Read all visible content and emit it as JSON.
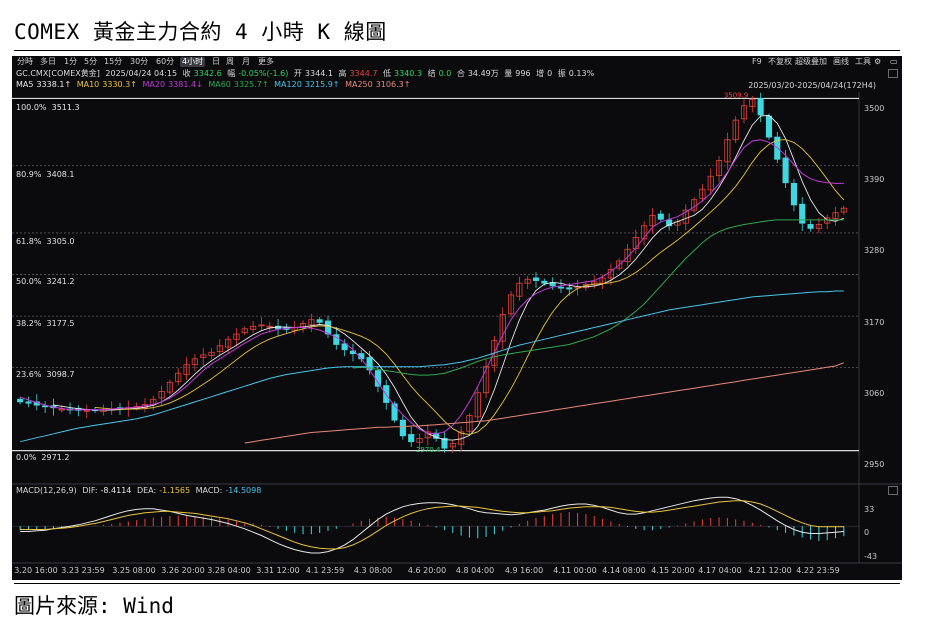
{
  "page": {
    "title": "COMEX 黃金主力合約 4 小時 K 線圖",
    "source": "圖片來源: Wind"
  },
  "toolbar": {
    "timeframes": [
      "分時",
      "多日",
      "1分",
      "5分",
      "15分",
      "30分",
      "60分",
      "4小时",
      "日",
      "周",
      "月",
      "更多"
    ],
    "active_timeframe": "4小时",
    "right_items": [
      "F9",
      "不复权",
      "超级叠加",
      "画线",
      "工具"
    ],
    "settings_icon": "gear-icon",
    "minimize_icon": "minimize-icon"
  },
  "info_line": {
    "symbol": "GC.CMX[COMEX黄金]",
    "datetime": "2025/04/24 04:15",
    "close_label": "收",
    "close": "3342.6",
    "change_label": "幅",
    "change": "-0.05%(-1.6)",
    "open_label": "开",
    "open": "3344.1",
    "high_label": "高",
    "high": "3344.7",
    "low_label": "低",
    "low": "3340.3",
    "settle_label": "结",
    "settle": "0.0",
    "turnover_label": "合",
    "turnover": "34.49万",
    "volume_label": "量",
    "volume": "996",
    "oi_change_label": "增",
    "oi_change": "0",
    "amplitude_label": "振",
    "amplitude": "0.13%"
  },
  "ma_line": [
    {
      "name": "MA5",
      "value": "3338.1↑",
      "color": "#e8e8e8"
    },
    {
      "name": "MA10",
      "value": "3330.3↑",
      "color": "#e8c33b"
    },
    {
      "name": "MA20",
      "value": "3381.4↓",
      "color": "#c03bd6"
    },
    {
      "name": "MA60",
      "value": "3325.7↑",
      "color": "#2fa84f"
    },
    {
      "name": "MA120",
      "value": "3215.9↑",
      "color": "#47c6e8"
    },
    {
      "name": "MA250",
      "value": "3106.3↑",
      "color": "#e8887a"
    }
  ],
  "range_label": "2025/03/20-2025/04/24(172H4)",
  "macd_legend": {
    "title": "MACD(12,26,9)",
    "dif_label": "DIF:",
    "dif": "-8.4114",
    "dea_label": "DEA:",
    "dea": "-1.1565",
    "macd_label": "MACD:",
    "macd": "-14.5098"
  },
  "colors": {
    "up": "#e8413b",
    "down": "#3fd7e0",
    "background": "#0b0b0d",
    "grid": "#5a5a62",
    "fib_line": "#d9d9de"
  },
  "chart_data": [
    {
      "type": "candlestick",
      "title": "COMEX 黃金主力合約 4 小時 K 線圖",
      "x_tick_labels": [
        "3.20 16:00",
        "3.23 23:59",
        "3.25 08:00",
        "3.26 20:00",
        "3.28 04:00",
        "3.31 12:00",
        "4.1 23:59",
        "4.3 08:00",
        "4.6 20:00",
        "4.8 04:00",
        "4.9 16:00",
        "4.11 00:00",
        "4.14 08:00",
        "4.15 20:00",
        "4.17 04:00",
        "4.21 12:00",
        "4.22 23:59"
      ],
      "y_ticks": [
        2950,
        3060,
        3170,
        3280,
        3390,
        3500
      ],
      "ylim": [
        2940,
        3515
      ],
      "fibonacci": [
        {
          "label": "100.0%",
          "value": 3511.3,
          "text": "3511.3"
        },
        {
          "label": "80.9%",
          "value": 3408.1,
          "text": "3408.1"
        },
        {
          "label": "61.8%",
          "value": 3305.0,
          "text": "3305.0"
        },
        {
          "label": "50.0%",
          "value": 3241.2,
          "text": "3241.2"
        },
        {
          "label": "38.2%",
          "value": 3177.5,
          "text": "3177.5"
        },
        {
          "label": "23.6%",
          "value": 3098.7,
          "text": "3098.7"
        },
        {
          "label": "0.0%",
          "value": 2971.2,
          "text": "2971.2"
        }
      ],
      "annotations": [
        {
          "text": "3509.9",
          "value": 3509.9,
          "kind": "high"
        },
        {
          "text": "2970.4",
          "value": 2970.4,
          "kind": "low"
        }
      ],
      "close_path": [
        3046,
        3044,
        3041,
        3039,
        3037,
        3035,
        3034,
        3033,
        3033,
        3033,
        3034,
        3035,
        3036,
        3037,
        3039,
        3042,
        3050,
        3062,
        3076,
        3090,
        3103,
        3112,
        3118,
        3122,
        3132,
        3142,
        3150,
        3158,
        3162,
        3164,
        3162,
        3158,
        3157,
        3160,
        3166,
        3172,
        3168,
        3150,
        3134,
        3126,
        3120,
        3112,
        3095,
        3070,
        3045,
        3018,
        2994,
        2985,
        2990,
        3000,
        2990,
        2975,
        2982,
        3000,
        3025,
        3060,
        3100,
        3140,
        3180,
        3210,
        3228,
        3234,
        3232,
        3228,
        3224,
        3221,
        3219,
        3222,
        3226,
        3230,
        3236,
        3249,
        3262,
        3280,
        3298,
        3316,
        3332,
        3326,
        3316,
        3322,
        3340,
        3356,
        3372,
        3392,
        3416,
        3448,
        3478,
        3500,
        3510,
        3486,
        3452,
        3418,
        3382,
        3348,
        3320,
        3312,
        3318,
        3328,
        3336,
        3343
      ],
      "moving_averages": [
        {
          "name": "MA20",
          "values": [
            3053,
            3049,
            3045,
            3041,
            3038,
            3036,
            3034,
            3034,
            3034,
            3034,
            3034,
            3035,
            3036,
            3037,
            3038,
            3040,
            3042,
            3046,
            3052,
            3060,
            3070,
            3082,
            3094,
            3104,
            3112,
            3120,
            3128,
            3136,
            3143,
            3150,
            3154,
            3157,
            3159,
            3160,
            3160,
            3159,
            3156,
            3151,
            3145,
            3137,
            3126,
            3112,
            3095,
            3076,
            3057,
            3040,
            3026,
            3014,
            3004,
            2998,
            2997,
            3000,
            3010,
            3026,
            3046,
            3070,
            3096,
            3122,
            3148,
            3172,
            3190,
            3203,
            3212,
            3218,
            3222,
            3224,
            3226,
            3228,
            3230,
            3232,
            3238,
            3246,
            3256,
            3268,
            3282,
            3298,
            3314,
            3322,
            3326,
            3330,
            3337,
            3345,
            3354,
            3366,
            3380,
            3398,
            3418,
            3436,
            3446,
            3448,
            3444,
            3436,
            3424,
            3410,
            3396,
            3388,
            3384,
            3382,
            3381,
            3381
          ]
        },
        {
          "name": "MA60",
          "values": [
            null,
            null,
            null,
            null,
            null,
            null,
            null,
            null,
            null,
            null,
            null,
            null,
            null,
            null,
            null,
            null,
            null,
            null,
            null,
            null,
            null,
            null,
            null,
            null,
            null,
            null,
            null,
            null,
            null,
            null,
            null,
            null,
            null,
            null,
            null,
            null,
            null,
            null,
            null,
            null,
            3098,
            3099,
            3098,
            3096,
            3094,
            3092,
            3090,
            3088,
            3087,
            3087,
            3088,
            3090,
            3094,
            3098,
            3103,
            3108,
            3112,
            3115,
            3118,
            3120,
            3122,
            3124,
            3126,
            3128,
            3130,
            3132,
            3134,
            3138,
            3142,
            3146,
            3152,
            3158,
            3166,
            3175,
            3185,
            3196,
            3210,
            3224,
            3238,
            3252,
            3266,
            3278,
            3290,
            3300,
            3307,
            3312,
            3315,
            3318,
            3320,
            3322,
            3324,
            3325,
            3325,
            3325,
            3325,
            3325,
            3325,
            3325,
            3325,
            3325
          ]
        },
        {
          "name": "MA120",
          "values": [
            2985,
            2988,
            2991,
            2994,
            2997,
            3000,
            3003,
            3006,
            3008,
            3010,
            3012,
            3014,
            3016,
            3018,
            3020,
            3023,
            3026,
            3030,
            3034,
            3038,
            3042,
            3046,
            3050,
            3054,
            3058,
            3062,
            3066,
            3070,
            3074,
            3078,
            3082,
            3085,
            3088,
            3090,
            3092,
            3094,
            3096,
            3098,
            3099,
            3100,
            3100,
            3100,
            3100,
            3100,
            3100,
            3100,
            3100,
            3100,
            3100,
            3101,
            3102,
            3103,
            3105,
            3107,
            3110,
            3113,
            3117,
            3121,
            3125,
            3129,
            3133,
            3136,
            3139,
            3142,
            3145,
            3148,
            3151,
            3154,
            3157,
            3160,
            3163,
            3166,
            3169,
            3172,
            3175,
            3178,
            3181,
            3184,
            3187,
            3189,
            3191,
            3193,
            3195,
            3197,
            3199,
            3201,
            3203,
            3205,
            3207,
            3208,
            3209,
            3210,
            3211,
            3212,
            3213,
            3214,
            3215,
            3215,
            3216,
            3216
          ]
        },
        {
          "name": "MA250",
          "values": [
            null,
            null,
            null,
            null,
            null,
            null,
            null,
            null,
            null,
            null,
            null,
            null,
            null,
            null,
            null,
            null,
            null,
            null,
            null,
            null,
            null,
            null,
            null,
            null,
            null,
            null,
            null,
            2983,
            2985,
            2987,
            2989,
            2991,
            2993,
            2995,
            2997,
            2999,
            3000,
            3001,
            3002,
            3003,
            3004,
            3005,
            3006,
            3007,
            3007,
            3008,
            3008,
            3009,
            3009,
            3010,
            3011,
            3012,
            3013,
            3014,
            3015,
            3016,
            3017,
            3019,
            3021,
            3023,
            3025,
            3027,
            3029,
            3031,
            3033,
            3035,
            3037,
            3039,
            3041,
            3043,
            3045,
            3047,
            3049,
            3051,
            3053,
            3055,
            3057,
            3059,
            3061,
            3063,
            3065,
            3067,
            3069,
            3071,
            3073,
            3075,
            3077,
            3079,
            3081,
            3083,
            3085,
            3087,
            3089,
            3091,
            3093,
            3095,
            3097,
            3099,
            3101,
            3106
          ]
        }
      ]
    },
    {
      "type": "macd",
      "title": "MACD(12,26,9)",
      "y_ticks": [
        33.0,
        0.0,
        -43.0
      ],
      "ylim": [
        -52,
        45
      ],
      "histogram": [
        -6,
        -6,
        -5,
        -5,
        -4,
        -3,
        -2,
        -1,
        0,
        1,
        2,
        3,
        5,
        7,
        9,
        11,
        13,
        14,
        15,
        16,
        16,
        15,
        14,
        13,
        12,
        10,
        8,
        6,
        4,
        2,
        -1,
        -4,
        -7,
        -10,
        -12,
        -12,
        -10,
        -7,
        -4,
        0,
        4,
        8,
        11,
        13,
        14,
        13,
        11,
        8,
        5,
        2,
        -2,
        -6,
        -10,
        -14,
        -17,
        -18,
        -16,
        -12,
        -7,
        -2,
        3,
        8,
        12,
        15,
        18,
        20,
        21,
        20,
        18,
        15,
        11,
        7,
        3,
        -1,
        -4,
        -6,
        -6,
        -4,
        -2,
        1,
        4,
        7,
        10,
        12,
        13,
        12,
        10,
        8,
        5,
        2,
        -2,
        -6,
        -10,
        -14,
        -17,
        -20,
        -22,
        -21,
        -18,
        -15
      ],
      "dif": [
        -8,
        -8,
        -7,
        -6,
        -4,
        -2,
        0,
        2,
        5,
        8,
        12,
        16,
        20,
        23,
        25,
        26,
        26,
        24,
        22,
        19,
        16,
        14,
        12,
        10,
        7,
        4,
        0,
        -4,
        -9,
        -14,
        -20,
        -26,
        -31,
        -35,
        -38,
        -40,
        -40,
        -38,
        -34,
        -28,
        -20,
        -10,
        0,
        10,
        18,
        24,
        29,
        32,
        34,
        35,
        35,
        34,
        32,
        29,
        26,
        22,
        20,
        19,
        18,
        17,
        18,
        20,
        22,
        24,
        27,
        30,
        32,
        33,
        33,
        31,
        28,
        24,
        20,
        18,
        18,
        20,
        23,
        26,
        29,
        32,
        35,
        38,
        40,
        42,
        43,
        43,
        41,
        37,
        31,
        24,
        16,
        8,
        1,
        -5,
        -9,
        -11,
        -11,
        -10,
        -9,
        -8
      ],
      "dea": [
        -5,
        -5,
        -5,
        -5,
        -4,
        -3,
        -2,
        0,
        2,
        4,
        7,
        10,
        13,
        16,
        18,
        20,
        21,
        22,
        22,
        21,
        20,
        19,
        17,
        15,
        13,
        11,
        8,
        5,
        1,
        -4,
        -9,
        -14,
        -19,
        -24,
        -28,
        -31,
        -33,
        -34,
        -34,
        -32,
        -28,
        -22,
        -15,
        -7,
        1,
        8,
        14,
        19,
        23,
        26,
        28,
        29,
        30,
        30,
        29,
        28,
        26,
        24,
        22,
        21,
        20,
        20,
        21,
        22,
        23,
        25,
        27,
        28,
        29,
        29,
        29,
        28,
        26,
        24,
        22,
        21,
        21,
        22,
        24,
        26,
        28,
        30,
        32,
        34,
        36,
        37,
        38,
        38,
        36,
        33,
        28,
        22,
        16,
        10,
        5,
        1,
        -1,
        -1,
        -1,
        -1
      ]
    }
  ]
}
